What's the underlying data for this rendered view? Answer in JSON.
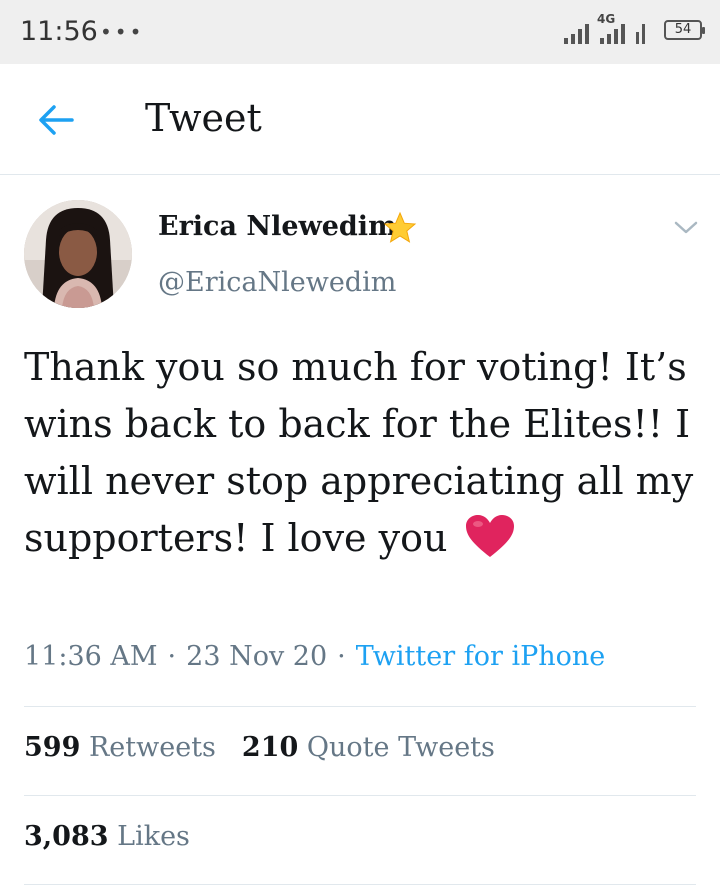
{
  "status_bar": {
    "time": "11:56",
    "dots": "•••",
    "network": "4G",
    "battery": "54"
  },
  "header": {
    "title": "Tweet",
    "back_icon": "arrow-left-icon"
  },
  "tweet": {
    "author_name": "Erica Nlewedim",
    "author_badge": "star-emoji",
    "handle": "@EricaNlewedim",
    "text": "Thank you so much for voting! It’s wins back to back for the Elites!! I will never stop appreciating all my supporters! I love you",
    "emoji": "red-heart-emoji",
    "time": "11:36 AM",
    "date": "23 Nov 20",
    "separator": "·",
    "source": "Twitter for iPhone"
  },
  "stats": {
    "retweets_count": "599",
    "retweets_label": "Retweets",
    "quotes_count": "210",
    "quotes_label": "Quote Tweets",
    "likes_count": "3,083",
    "likes_label": "Likes"
  },
  "colors": {
    "accent": "#1da1f2",
    "secondary_text": "#657786",
    "primary_text": "#14171a",
    "divider": "#e1e8ed",
    "heart": "#e0245e",
    "star": "#ffcc33"
  }
}
